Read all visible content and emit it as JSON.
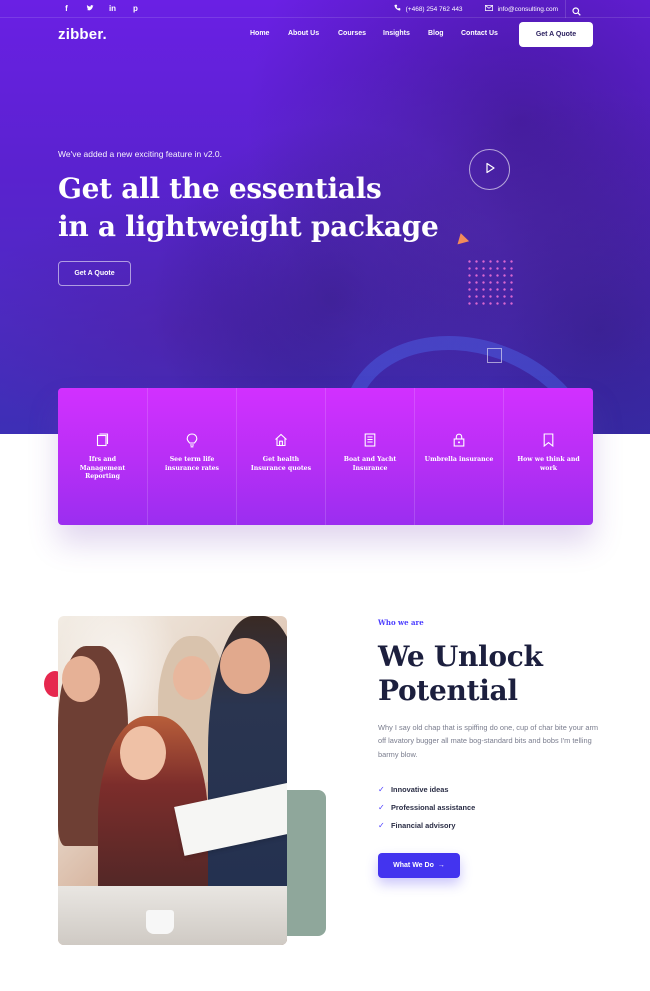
{
  "topbar": {
    "social": [
      {
        "icon": "facebook-icon",
        "glyph": "f"
      },
      {
        "icon": "twitter-icon",
        "glyph": "t"
      },
      {
        "icon": "linkedin-icon",
        "glyph": "in"
      },
      {
        "icon": "pinterest-icon",
        "glyph": "p"
      }
    ],
    "phone": "(+468) 254 762 443",
    "email": "info@consulting.com",
    "search_icon": "search-icon"
  },
  "header": {
    "logo": "zibber.",
    "nav": [
      "Home",
      "About Us",
      "Courses",
      "Insights",
      "Blog",
      "Contact Us"
    ],
    "quote_button": "Get A Quote"
  },
  "hero": {
    "subtitle": "We've added a new exciting feature in v2.0.",
    "title_line1": "Get all the essentials",
    "title_line2": "in a lightweight package",
    "button": "Get A Quote",
    "play_icon": "play-icon"
  },
  "features": [
    {
      "icon": "book-icon",
      "label": "Ifrs and Management Reporting"
    },
    {
      "icon": "bulb-icon",
      "label": "See term life insurance rates"
    },
    {
      "icon": "home-icon",
      "label": "Get health Insurance quotes"
    },
    {
      "icon": "document-icon",
      "label": "Boat and Yacht Insurance"
    },
    {
      "icon": "lock-icon",
      "label": "Umbrella insurance"
    },
    {
      "icon": "bookmark-icon",
      "label": "How we think and work"
    }
  ],
  "about": {
    "eyebrow": "Who we are",
    "title_line1": "We Unlock",
    "title_line2": "Potential",
    "body": "Why I say old chap that is spiffing do one, cup of char bite your arm off lavatory bugger all mate bog-standard bits and bobs I'm telling barmy blow.",
    "checks": [
      "Innovative ideas",
      "Professional assistance",
      "Financial advisory"
    ],
    "button": "What We Do",
    "button_arrow": "→"
  },
  "colors": {
    "hero_top": "#6a20e4",
    "feature_top": "#d230ff",
    "feature_bottom": "#9b2ef0",
    "accent": "#4334ef",
    "heading": "#1c1f3e"
  }
}
